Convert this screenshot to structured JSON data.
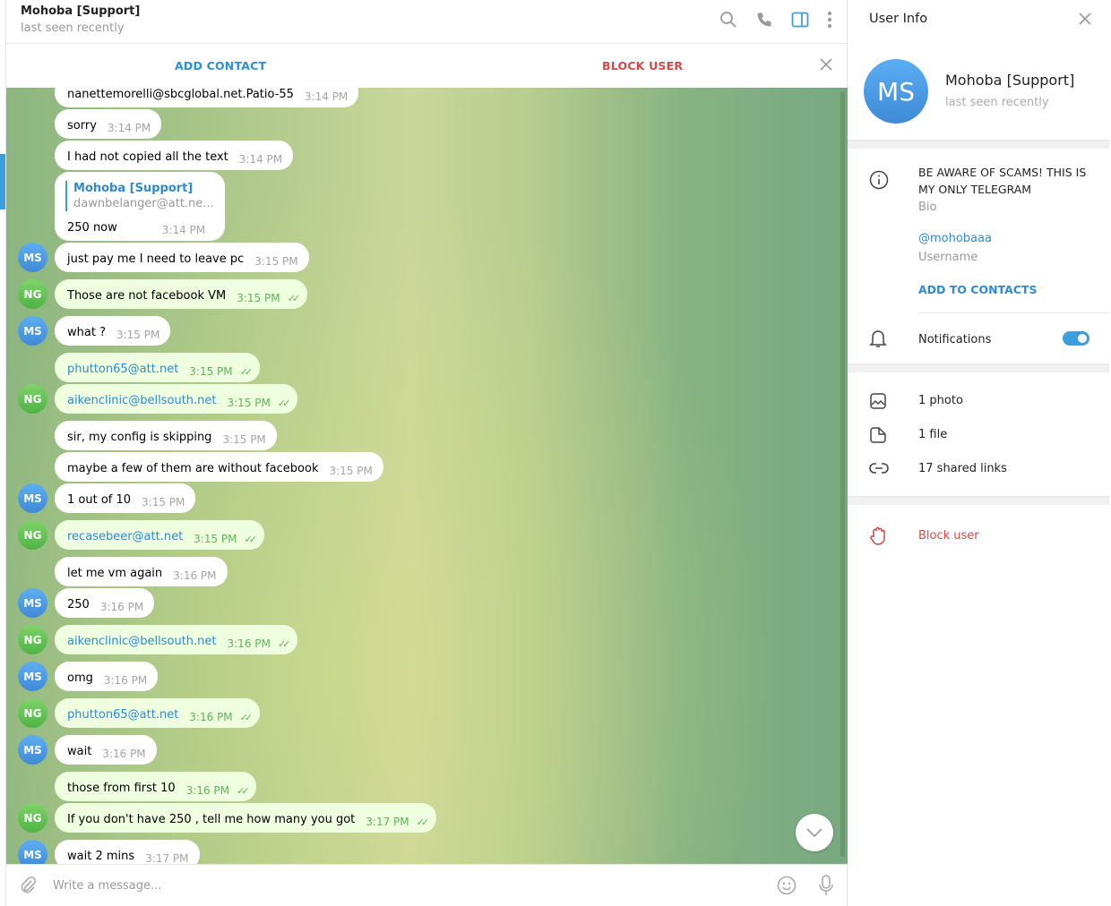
{
  "header": {
    "title": "Mohoba [Support]",
    "status": "last seen recently",
    "icons": [
      "search-icon",
      "phone-icon",
      "sidebar-toggle-icon",
      "more-vertical-icon"
    ]
  },
  "actionbar": {
    "add_contact": "ADD CONTACT",
    "block_user": "BLOCK USER"
  },
  "colors": {
    "accent": "#3e9ddb",
    "danger": "#d24949",
    "outgoing_bubble": "#eefedf",
    "incoming_bubble": "#ffffff",
    "ms_avatar": "#4a9ae4",
    "ng_avatar": "#5dbf4f"
  },
  "messages": [
    {
      "from": "MS",
      "text": "nanettemorelli@sbcglobal.net.Patio-55",
      "time": "3:14 PM",
      "link": false
    },
    {
      "from": "MS",
      "text": "sorry",
      "time": "3:14 PM"
    },
    {
      "from": "MS",
      "text": "I had not copied all the text",
      "time": "3:14 PM"
    },
    {
      "from": "MS",
      "text": "250 now",
      "time": "3:14 PM",
      "reply": {
        "name": "Mohoba [Support]",
        "text": "dawnbelanger@att.ne..."
      }
    },
    {
      "from": "MS",
      "text": "just pay me I need to leave pc",
      "time": "3:15 PM"
    },
    {
      "from": "NG",
      "text": "Those are not facebook VM",
      "time": "3:15 PM"
    },
    {
      "from": "MS",
      "text": "what ?",
      "time": "3:15 PM"
    },
    {
      "from": "NG",
      "text": "phutton65@att.net",
      "time": "3:15 PM",
      "link": true
    },
    {
      "from": "NG",
      "text": "aikenclinic@bellsouth.net",
      "time": "3:15 PM",
      "link": true
    },
    {
      "from": "MS",
      "text": "sir, my config is skipping",
      "time": "3:15 PM"
    },
    {
      "from": "MS",
      "text": "maybe a few of them are without facebook",
      "time": "3:15 PM"
    },
    {
      "from": "MS",
      "text": "1 out of 10",
      "time": "3:15 PM"
    },
    {
      "from": "NG",
      "text": "recasebeer@att.net",
      "time": "3:15 PM",
      "link": true
    },
    {
      "from": "MS",
      "text": "let me vm again",
      "time": "3:16 PM"
    },
    {
      "from": "MS",
      "text": "250",
      "time": "3:16 PM"
    },
    {
      "from": "NG",
      "text": "aikenclinic@bellsouth.net",
      "time": "3:16 PM",
      "link": true
    },
    {
      "from": "MS",
      "text": "omg",
      "time": "3:16 PM"
    },
    {
      "from": "NG",
      "text": "phutton65@att.net",
      "time": "3:16 PM",
      "link": true
    },
    {
      "from": "MS",
      "text": "wait",
      "time": "3:16 PM"
    },
    {
      "from": "NG",
      "text": "those from first 10",
      "time": "3:16 PM"
    },
    {
      "from": "NG",
      "text": "If you don't have 250 , tell me how many you got",
      "time": "3:17 PM"
    },
    {
      "from": "MS",
      "text": "wait 2 mins",
      "time": "3:17 PM"
    }
  ],
  "composer": {
    "placeholder": "Write a message..."
  },
  "panel": {
    "title": "User Info",
    "avatar": "MS",
    "name": "Mohoba [Support]",
    "status": "last seen recently",
    "bio": "BE AWARE OF SCAMS! THIS IS MY ONLY TELEGRAM",
    "bio_label": "Bio",
    "username": "@mohobaaa",
    "username_label": "Username",
    "add_to_contacts": "ADD TO CONTACTS",
    "notifications": "Notifications",
    "notifications_on": true,
    "photos": "1 photo",
    "files": "1 file",
    "links": "17 shared links",
    "block": "Block user"
  }
}
